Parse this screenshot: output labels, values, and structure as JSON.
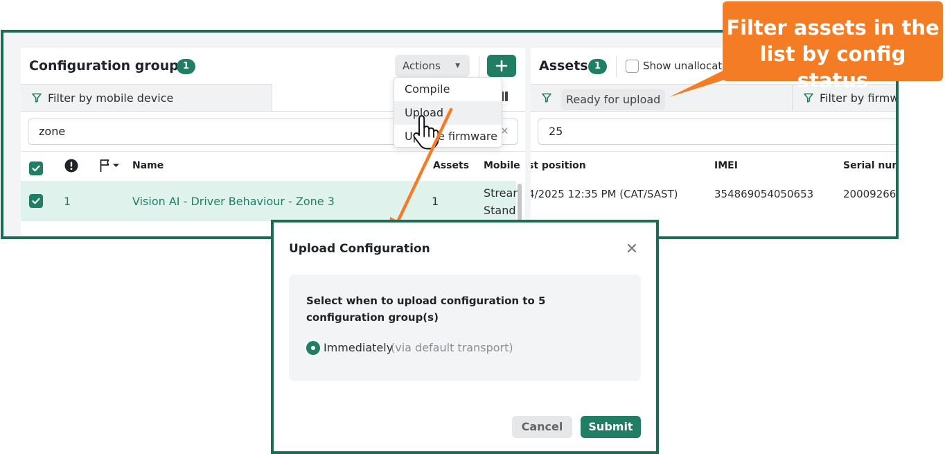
{
  "config_groups": {
    "title": "Configuration groups",
    "count": "1",
    "actions_label": "Actions",
    "filter_label": "Filter by mobile device",
    "search_value": "zone",
    "columns": {
      "assets": "Assets",
      "name": "Name",
      "mobile": "Mobile"
    },
    "row": {
      "index": "1",
      "name": "Vision AI - Driver Behaviour - Zone 3",
      "assets": "1",
      "mobile_line1": "Strear",
      "mobile_line2": "Stand"
    }
  },
  "actions_menu": {
    "items": [
      "Compile",
      "Upload",
      "Update firmware"
    ]
  },
  "assets": {
    "title": "Assets",
    "count": "1",
    "show_unallocated": "Show unallocated",
    "status_filter": "Ready for upload",
    "firmware_filter": "Filter by firmw",
    "search_value": "25",
    "columns": {
      "last_position": "st position",
      "imei": "IMEI",
      "serial": "Serial num"
    },
    "row": {
      "last_position": "4/2025 12:35 PM (CAT/SAST)",
      "imei": "354869054050653",
      "serial": "20009266"
    }
  },
  "callout": {
    "line1": "Filter assets in the",
    "line2": "list by config status"
  },
  "modal": {
    "title": "Upload Configuration",
    "prompt": "Select when to upload configuration to 5 configuration group(s)",
    "option_label": "Immediately",
    "option_sub": "(via default transport)",
    "cancel_label": "Cancel",
    "submit_label": "Submit"
  },
  "colors": {
    "brand_green": "#1f7e63",
    "frame_green": "#1d6b55",
    "callout_orange": "#f47c24",
    "row_highlight": "#dff3ec"
  },
  "icons": {
    "filter": "funnel-icon",
    "alert": "exclamation-circle-icon",
    "flag": "flag-dropdown-icon",
    "add": "plus-icon",
    "close": "close-icon",
    "cursor": "hand-pointer-icon",
    "columns": "columns-icon"
  }
}
